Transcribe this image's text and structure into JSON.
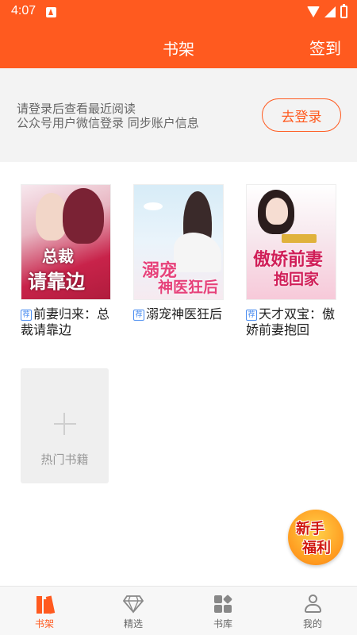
{
  "status_bar": {
    "time": "4:07"
  },
  "header": {
    "title": "书架",
    "checkin_label": "签到"
  },
  "login_banner": {
    "line1": "请登录后查看最近阅读",
    "line2": "公众号用户微信登录 同步账户信息",
    "button_label": "去登录"
  },
  "books": [
    {
      "badge": "荐",
      "title": "前妻归来：总裁请靠边",
      "cover_text1": "总裁",
      "cover_text2": "请靠边"
    },
    {
      "badge": "荐",
      "title": "溺宠神医狂后",
      "cover_text1": "溺宠",
      "cover_text2": "神医狂后"
    },
    {
      "badge": "荐",
      "title": "天才双宝：傲娇前妻抱回",
      "cover_text1": "傲娇前妻",
      "cover_text2": "抱回家"
    }
  ],
  "add_tile": {
    "label": "热门书籍"
  },
  "newbie_badge": {
    "line1": "新手",
    "line2": "福利"
  },
  "bottom_nav": [
    {
      "label": "书架",
      "icon": "bookshelf-icon",
      "active": true
    },
    {
      "label": "精选",
      "icon": "diamond-icon",
      "active": false
    },
    {
      "label": "书库",
      "icon": "library-grid-icon",
      "active": false
    },
    {
      "label": "我的",
      "icon": "user-icon",
      "active": false
    }
  ],
  "colors": {
    "accent": "#ff5a1f",
    "link_badge": "#4a8cf0"
  }
}
